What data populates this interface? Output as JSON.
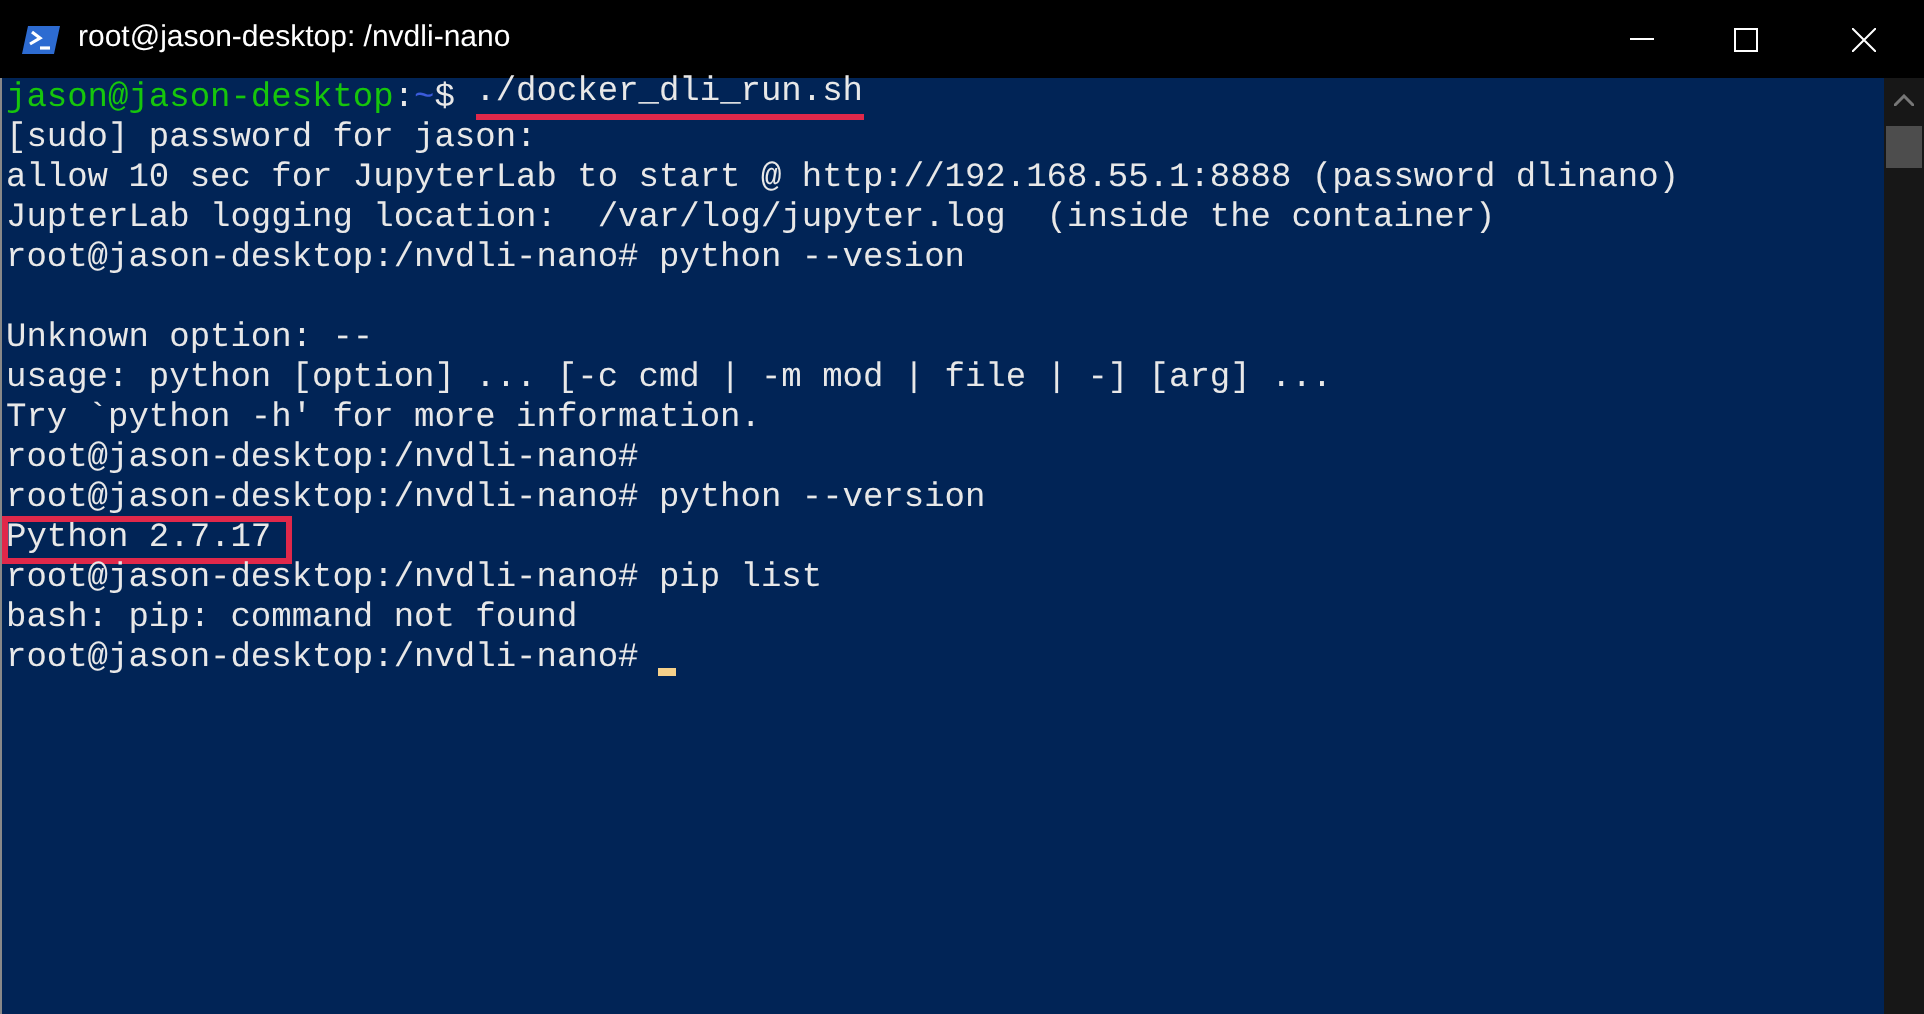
{
  "window": {
    "title": "root@jason-desktop: /nvdli-nano"
  },
  "terminal": {
    "lines": [
      {
        "kind": "text",
        "segments": [
          {
            "text": "jason@jason-desktop",
            "kind": "user",
            "underlined": false,
            "boxed": false
          },
          {
            "text": ":",
            "kind": "plain",
            "underlined": false,
            "boxed": false
          },
          {
            "text": "~",
            "kind": "path",
            "underlined": false,
            "boxed": false
          },
          {
            "text": "$ ",
            "kind": "plain",
            "underlined": false,
            "boxed": false
          },
          {
            "text": "./docker_dli_run.sh",
            "kind": "plain",
            "underlined": true,
            "boxed": false
          }
        ]
      },
      {
        "kind": "text",
        "segments": [
          {
            "text": "[sudo] password for jason:",
            "kind": "plain",
            "underlined": false,
            "boxed": false
          }
        ]
      },
      {
        "kind": "text",
        "segments": [
          {
            "text": "allow 10 sec for JupyterLab to start @ http://192.168.55.1:8888 (password dlinano)",
            "kind": "plain",
            "underlined": false,
            "boxed": false
          }
        ]
      },
      {
        "kind": "text",
        "segments": [
          {
            "text": "JupterLab logging location:  /var/log/jupyter.log  (inside the container)",
            "kind": "plain",
            "underlined": false,
            "boxed": false
          }
        ]
      },
      {
        "kind": "text",
        "segments": [
          {
            "text": "root@jason-desktop:/nvdli-nano# python --vesion",
            "kind": "plain",
            "underlined": false,
            "boxed": false
          }
        ]
      },
      {
        "kind": "blank"
      },
      {
        "kind": "text",
        "segments": [
          {
            "text": "Unknown option: --",
            "kind": "plain",
            "underlined": false,
            "boxed": false
          }
        ]
      },
      {
        "kind": "text",
        "segments": [
          {
            "text": "usage: python [option] ... [-c cmd | -m mod | file | -] [arg] ...",
            "kind": "plain",
            "underlined": false,
            "boxed": false
          }
        ]
      },
      {
        "kind": "text",
        "segments": [
          {
            "text": "Try `python -h' for more information.",
            "kind": "plain",
            "underlined": false,
            "boxed": false
          }
        ]
      },
      {
        "kind": "text",
        "segments": [
          {
            "text": "root@jason-desktop:/nvdli-nano#",
            "kind": "plain",
            "underlined": false,
            "boxed": false
          }
        ]
      },
      {
        "kind": "text",
        "segments": [
          {
            "text": "root@jason-desktop:/nvdli-nano# python --version",
            "kind": "plain",
            "underlined": false,
            "boxed": false
          }
        ]
      },
      {
        "kind": "text",
        "segments": [
          {
            "text": "Python 2.7.17",
            "kind": "plain",
            "underlined": false,
            "boxed": true
          }
        ]
      },
      {
        "kind": "text",
        "segments": [
          {
            "text": "root@jason-desktop:/nvdli-nano# pip list",
            "kind": "plain",
            "underlined": false,
            "boxed": false
          }
        ]
      },
      {
        "kind": "text",
        "segments": [
          {
            "text": "bash: pip: command not found",
            "kind": "plain",
            "underlined": false,
            "boxed": false
          }
        ]
      },
      {
        "kind": "prompt",
        "segments": [
          {
            "text": "root@jason-desktop:/nvdli-nano#",
            "kind": "plain",
            "underlined": false,
            "boxed": false
          }
        ]
      }
    ]
  }
}
